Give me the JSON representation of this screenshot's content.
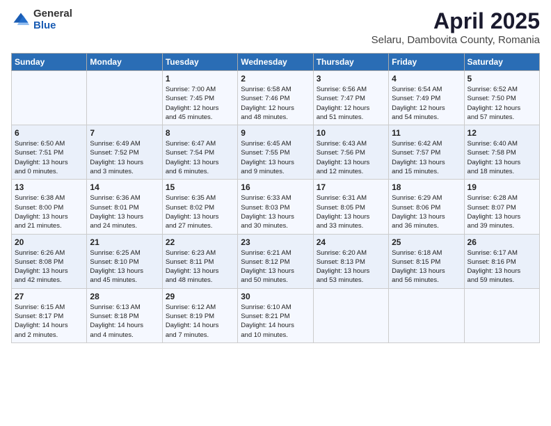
{
  "header": {
    "logo_general": "General",
    "logo_blue": "Blue",
    "title": "April 2025",
    "subtitle": "Selaru, Dambovita County, Romania"
  },
  "days_of_week": [
    "Sunday",
    "Monday",
    "Tuesday",
    "Wednesday",
    "Thursday",
    "Friday",
    "Saturday"
  ],
  "weeks": [
    [
      {
        "day": "",
        "lines": []
      },
      {
        "day": "",
        "lines": []
      },
      {
        "day": "1",
        "lines": [
          "Sunrise: 7:00 AM",
          "Sunset: 7:45 PM",
          "Daylight: 12 hours",
          "and 45 minutes."
        ]
      },
      {
        "day": "2",
        "lines": [
          "Sunrise: 6:58 AM",
          "Sunset: 7:46 PM",
          "Daylight: 12 hours",
          "and 48 minutes."
        ]
      },
      {
        "day": "3",
        "lines": [
          "Sunrise: 6:56 AM",
          "Sunset: 7:47 PM",
          "Daylight: 12 hours",
          "and 51 minutes."
        ]
      },
      {
        "day": "4",
        "lines": [
          "Sunrise: 6:54 AM",
          "Sunset: 7:49 PM",
          "Daylight: 12 hours",
          "and 54 minutes."
        ]
      },
      {
        "day": "5",
        "lines": [
          "Sunrise: 6:52 AM",
          "Sunset: 7:50 PM",
          "Daylight: 12 hours",
          "and 57 minutes."
        ]
      }
    ],
    [
      {
        "day": "6",
        "lines": [
          "Sunrise: 6:50 AM",
          "Sunset: 7:51 PM",
          "Daylight: 13 hours",
          "and 0 minutes."
        ]
      },
      {
        "day": "7",
        "lines": [
          "Sunrise: 6:49 AM",
          "Sunset: 7:52 PM",
          "Daylight: 13 hours",
          "and 3 minutes."
        ]
      },
      {
        "day": "8",
        "lines": [
          "Sunrise: 6:47 AM",
          "Sunset: 7:54 PM",
          "Daylight: 13 hours",
          "and 6 minutes."
        ]
      },
      {
        "day": "9",
        "lines": [
          "Sunrise: 6:45 AM",
          "Sunset: 7:55 PM",
          "Daylight: 13 hours",
          "and 9 minutes."
        ]
      },
      {
        "day": "10",
        "lines": [
          "Sunrise: 6:43 AM",
          "Sunset: 7:56 PM",
          "Daylight: 13 hours",
          "and 12 minutes."
        ]
      },
      {
        "day": "11",
        "lines": [
          "Sunrise: 6:42 AM",
          "Sunset: 7:57 PM",
          "Daylight: 13 hours",
          "and 15 minutes."
        ]
      },
      {
        "day": "12",
        "lines": [
          "Sunrise: 6:40 AM",
          "Sunset: 7:58 PM",
          "Daylight: 13 hours",
          "and 18 minutes."
        ]
      }
    ],
    [
      {
        "day": "13",
        "lines": [
          "Sunrise: 6:38 AM",
          "Sunset: 8:00 PM",
          "Daylight: 13 hours",
          "and 21 minutes."
        ]
      },
      {
        "day": "14",
        "lines": [
          "Sunrise: 6:36 AM",
          "Sunset: 8:01 PM",
          "Daylight: 13 hours",
          "and 24 minutes."
        ]
      },
      {
        "day": "15",
        "lines": [
          "Sunrise: 6:35 AM",
          "Sunset: 8:02 PM",
          "Daylight: 13 hours",
          "and 27 minutes."
        ]
      },
      {
        "day": "16",
        "lines": [
          "Sunrise: 6:33 AM",
          "Sunset: 8:03 PM",
          "Daylight: 13 hours",
          "and 30 minutes."
        ]
      },
      {
        "day": "17",
        "lines": [
          "Sunrise: 6:31 AM",
          "Sunset: 8:05 PM",
          "Daylight: 13 hours",
          "and 33 minutes."
        ]
      },
      {
        "day": "18",
        "lines": [
          "Sunrise: 6:29 AM",
          "Sunset: 8:06 PM",
          "Daylight: 13 hours",
          "and 36 minutes."
        ]
      },
      {
        "day": "19",
        "lines": [
          "Sunrise: 6:28 AM",
          "Sunset: 8:07 PM",
          "Daylight: 13 hours",
          "and 39 minutes."
        ]
      }
    ],
    [
      {
        "day": "20",
        "lines": [
          "Sunrise: 6:26 AM",
          "Sunset: 8:08 PM",
          "Daylight: 13 hours",
          "and 42 minutes."
        ]
      },
      {
        "day": "21",
        "lines": [
          "Sunrise: 6:25 AM",
          "Sunset: 8:10 PM",
          "Daylight: 13 hours",
          "and 45 minutes."
        ]
      },
      {
        "day": "22",
        "lines": [
          "Sunrise: 6:23 AM",
          "Sunset: 8:11 PM",
          "Daylight: 13 hours",
          "and 48 minutes."
        ]
      },
      {
        "day": "23",
        "lines": [
          "Sunrise: 6:21 AM",
          "Sunset: 8:12 PM",
          "Daylight: 13 hours",
          "and 50 minutes."
        ]
      },
      {
        "day": "24",
        "lines": [
          "Sunrise: 6:20 AM",
          "Sunset: 8:13 PM",
          "Daylight: 13 hours",
          "and 53 minutes."
        ]
      },
      {
        "day": "25",
        "lines": [
          "Sunrise: 6:18 AM",
          "Sunset: 8:15 PM",
          "Daylight: 13 hours",
          "and 56 minutes."
        ]
      },
      {
        "day": "26",
        "lines": [
          "Sunrise: 6:17 AM",
          "Sunset: 8:16 PM",
          "Daylight: 13 hours",
          "and 59 minutes."
        ]
      }
    ],
    [
      {
        "day": "27",
        "lines": [
          "Sunrise: 6:15 AM",
          "Sunset: 8:17 PM",
          "Daylight: 14 hours",
          "and 2 minutes."
        ]
      },
      {
        "day": "28",
        "lines": [
          "Sunrise: 6:13 AM",
          "Sunset: 8:18 PM",
          "Daylight: 14 hours",
          "and 4 minutes."
        ]
      },
      {
        "day": "29",
        "lines": [
          "Sunrise: 6:12 AM",
          "Sunset: 8:19 PM",
          "Daylight: 14 hours",
          "and 7 minutes."
        ]
      },
      {
        "day": "30",
        "lines": [
          "Sunrise: 6:10 AM",
          "Sunset: 8:21 PM",
          "Daylight: 14 hours",
          "and 10 minutes."
        ]
      },
      {
        "day": "",
        "lines": []
      },
      {
        "day": "",
        "lines": []
      },
      {
        "day": "",
        "lines": []
      }
    ]
  ]
}
